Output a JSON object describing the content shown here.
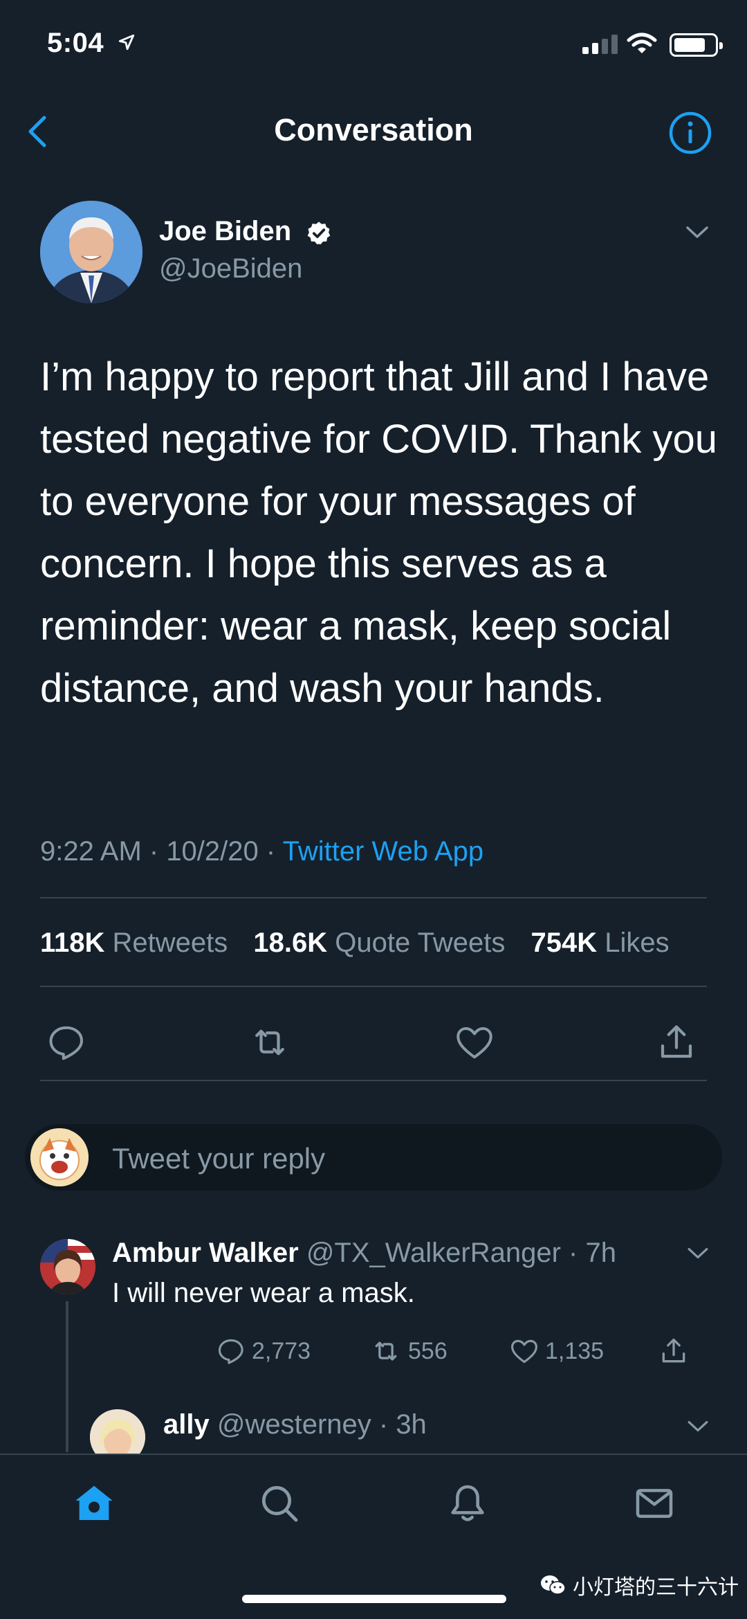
{
  "status_bar": {
    "time": "5:04"
  },
  "header": {
    "title": "Conversation"
  },
  "tweet": {
    "author_name": "Joe Biden",
    "author_handle": "@JoeBiden",
    "text": "I’m happy to report that Jill and I have tested negative for COVID. Thank you to everyone for your messages of concern. I hope this serves as a reminder: wear a mask, keep social distance, and wash your hands.",
    "time": "9:22 AM",
    "date": "10/2/20",
    "source": "Twitter Web App",
    "stats": {
      "retweets_count": "118K",
      "retweets_label": "Retweets",
      "quotes_count": "18.6K",
      "quotes_label": "Quote Tweets",
      "likes_count": "754K",
      "likes_label": "Likes"
    }
  },
  "reply_composer": {
    "placeholder": "Tweet your reply"
  },
  "replies": [
    {
      "author_name": "Ambur Walker",
      "author_handle": "@TX_WalkerRanger",
      "age": "7h",
      "text": "I will never wear a mask.",
      "reply_count": "2,773",
      "retweet_count": "556",
      "like_count": "1,135"
    },
    {
      "author_name": "ally",
      "author_handle": "@westerney",
      "age": "3h"
    }
  ],
  "watermark": "小灯塔的三十六计",
  "colors": {
    "background": "#15202b",
    "accent": "#1da1f2",
    "muted": "#8899a6",
    "divider": "#38444d"
  }
}
